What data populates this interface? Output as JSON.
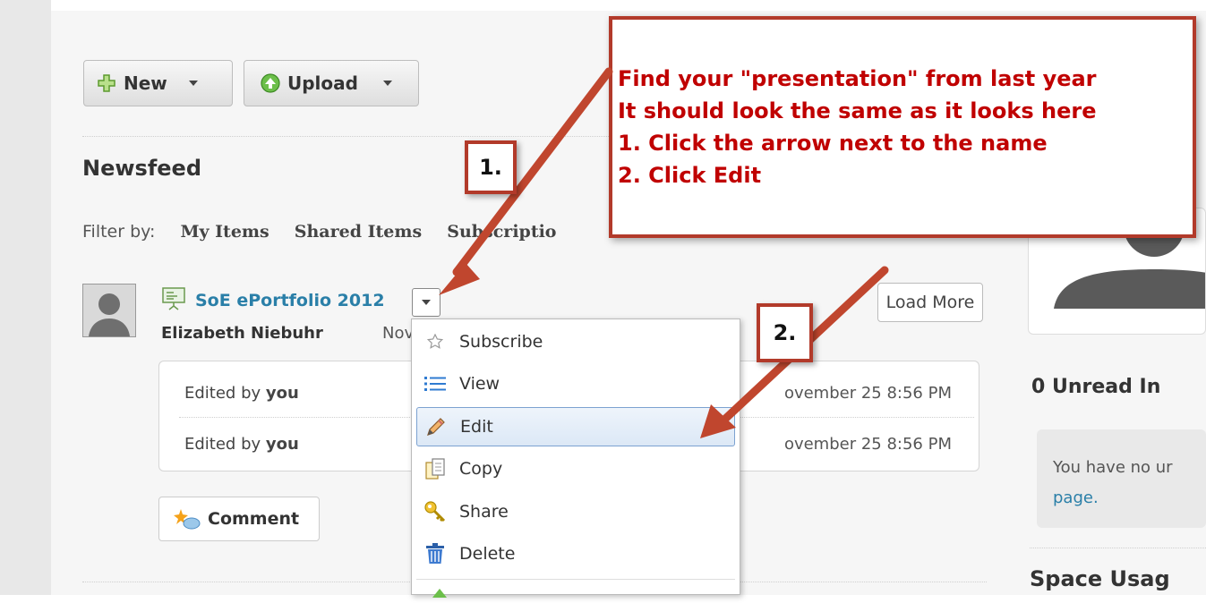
{
  "toolbar": {
    "new_label": "New",
    "upload_label": "Upload"
  },
  "newsfeed": {
    "title": "Newsfeed",
    "filter_label": "Filter by:",
    "filters": [
      "My Items",
      "Shared Items",
      "Subscriptio"
    ]
  },
  "item": {
    "title": "SoE ePortfolio 2012",
    "author": "Elizabeth Niebuhr",
    "date": "Nov",
    "activity": [
      {
        "prefix": "Edited by ",
        "who": "you",
        "time": "ovember 25 8:56 PM"
      },
      {
        "prefix": "Edited by ",
        "who": "you",
        "time": "ovember 25 8:56 PM"
      }
    ],
    "comment_label": "Comment"
  },
  "load_more_label": "Load More",
  "menu": {
    "items": [
      {
        "label": "Subscribe",
        "icon": "star-icon"
      },
      {
        "label": "View",
        "icon": "list-icon"
      },
      {
        "label": "Edit",
        "icon": "pencil-icon"
      },
      {
        "label": "Copy",
        "icon": "copy-icon"
      },
      {
        "label": "Share",
        "icon": "key-icon"
      },
      {
        "label": "Delete",
        "icon": "trash-icon"
      }
    ]
  },
  "right": {
    "unread_title": "0 Unread In",
    "notice_line1": "You have no ur",
    "notice_link": "page.",
    "space_title": "Space Usag"
  },
  "annotation": {
    "lines": [
      "Find your \"presentation\" from last year",
      "It should look the same as it looks here",
      "1. Click the arrow next to the name",
      "2. Click Edit"
    ],
    "badge1": "1.",
    "badge2": "2."
  },
  "colors": {
    "link": "#2a7fa8",
    "annotation_red": "#c00000",
    "annotation_border": "#b23a2a"
  }
}
